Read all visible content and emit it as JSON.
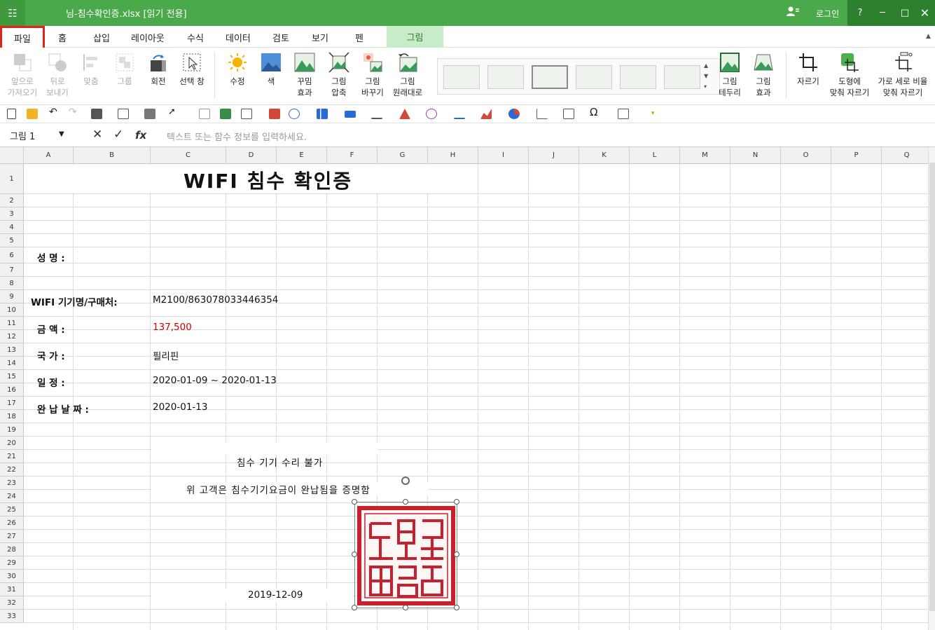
{
  "window": {
    "title": "님-침수확인증.xlsx [읽기 전용]",
    "login_label": "로그인",
    "help_label": "?",
    "minimize_label": "─",
    "maximize_label": "□",
    "close_label": "✕",
    "appmenu_label": "☷"
  },
  "menu": {
    "file": "파일",
    "home": "홈",
    "insert": "삽입",
    "layout": "레이아웃",
    "formulas": "수식",
    "data": "데이터",
    "review": "검토",
    "view": "보기",
    "pen": "펜",
    "picture": "그림"
  },
  "ribbon": {
    "bring_forward_1": "앞으로",
    "bring_forward_2": "가져오기",
    "send_back_1": "뒤로",
    "send_back_2": "보내기",
    "align": "맞춤",
    "group": "그룹",
    "rotate": "회전",
    "selection_pane": "선택 창",
    "corrections": "수정",
    "color": "색",
    "artistic_1": "꾸밈",
    "artistic_2": "효과",
    "compress_1": "그림",
    "compress_2": "압축",
    "change_1": "그림",
    "change_2": "바꾸기",
    "reset_1": "그림",
    "reset_2": "원래대로",
    "border_1": "그림",
    "border_2": "테두리",
    "effects_1": "그림",
    "effects_2": "효과",
    "crop": "자르기",
    "crop_shape_1": "도형에",
    "crop_shape_2": "맞춰 자르기",
    "crop_ratio_1": "가로 세로 비율",
    "crop_ratio_2": "맞춰 자르기"
  },
  "formula_bar": {
    "name_box": "그림 1",
    "cancel": "✕",
    "enter": "✓",
    "fx": "fx",
    "placeholder": "텍스트 또는 함수 정보를 입력하세요."
  },
  "columns": [
    "A",
    "B",
    "C",
    "D",
    "E",
    "F",
    "G",
    "H",
    "I",
    "J",
    "K",
    "L",
    "M",
    "N",
    "O",
    "P",
    "Q"
  ],
  "rows": [
    "1",
    "2",
    "3",
    "4",
    "5",
    "6",
    "7",
    "8",
    "9",
    "10",
    "11",
    "12",
    "13",
    "14",
    "15",
    "16",
    "17",
    "18",
    "19",
    "20",
    "21",
    "22",
    "23",
    "24",
    "25",
    "26",
    "27",
    "28",
    "29",
    "30",
    "31",
    "32",
    "33"
  ],
  "sheet": {
    "title": "WIFI 침수 확인증",
    "name_label": "성        명 :",
    "device_label": "WIFI 기기명/구매처:",
    "device_value": "M2100/863078033446354",
    "amount_label": "금        액 :",
    "amount_value": "137,500",
    "country_label": "국        가 :",
    "country_value": "필리핀",
    "schedule_label": "일        정 :",
    "schedule_value": "2020-01-09 ~ 2020-01-13",
    "paid_label": "완  납 날 짜 :",
    "paid_value": "2020-01-13",
    "note1": "침수 기기 수리 불가",
    "note2": "위 고객은  침수기기요금이 완납됨을 증명함",
    "date": "2019-12-09"
  },
  "colors": {
    "titlebar": "#4aa94a",
    "accent_tab": "#c8ebc8",
    "amount": "#cc0000",
    "stamp": "#c8202c",
    "highlight": "#e8201c"
  }
}
